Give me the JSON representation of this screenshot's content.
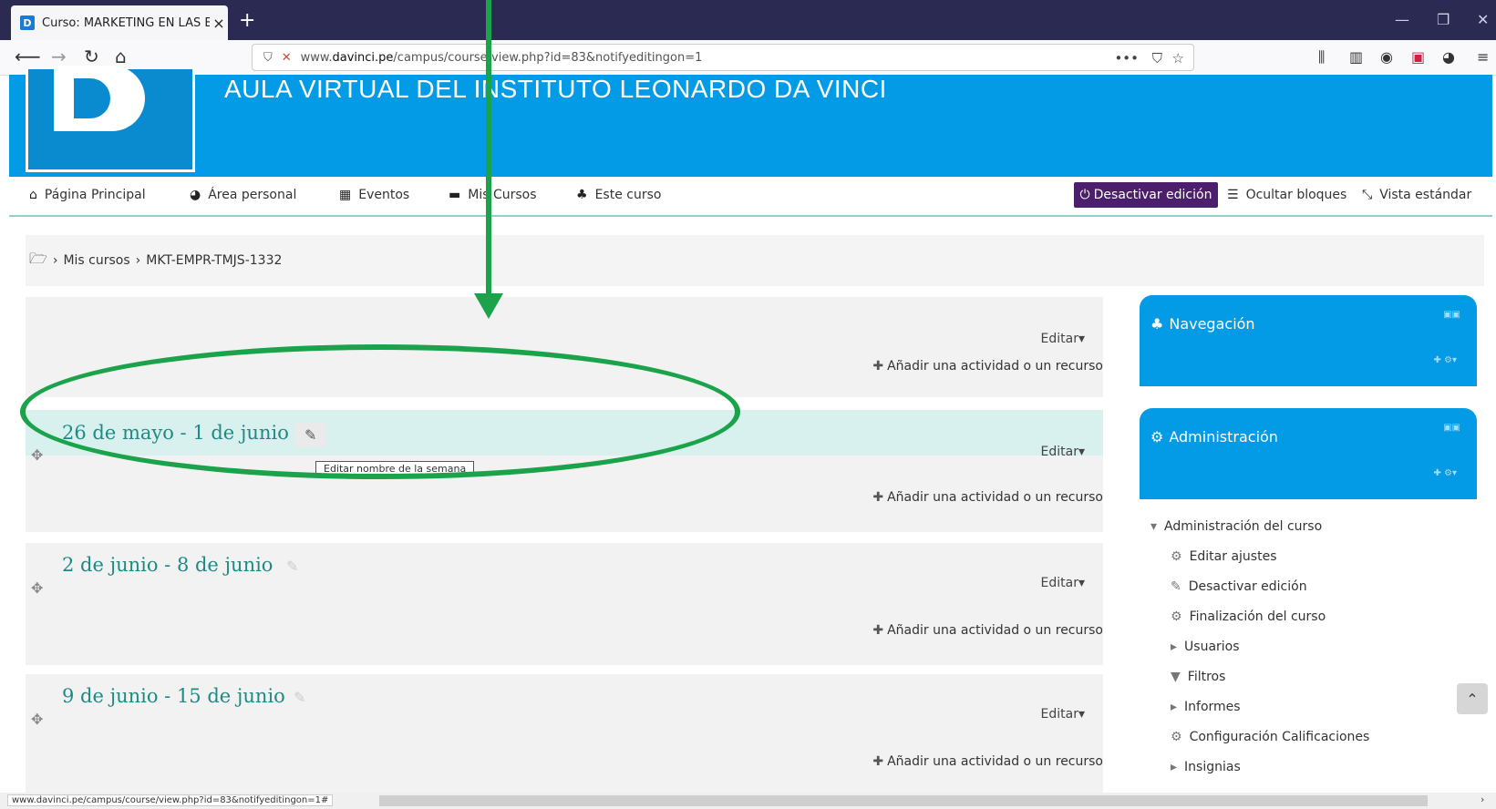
{
  "browser": {
    "tab_title": "Curso: MARKETING EN LAS EM",
    "tab_favicon": "D",
    "url_prefix": "www.",
    "url_domain": "davinci.pe",
    "url_path": "/campus/course/view.php?id=83&notifyeditingon=1",
    "new_tab": "+",
    "url_menu": "•••"
  },
  "header": {
    "site_title": "AULA VIRTUAL DEL INSTITUTO LEONARDO DA VINCI"
  },
  "nav": {
    "home": "Página Principal",
    "personal": "Área personal",
    "events": "Eventos",
    "my_courses": "Mis Cursos",
    "this_course": "Este curso",
    "edit_toggle": "Desactivar edición",
    "hide_blocks": "Ocultar bloques",
    "standard_view": "Vista estándar"
  },
  "breadcrumb": {
    "item1": "Mis cursos",
    "item2": "MKT-EMPR-TMJS-1332"
  },
  "sections": [
    {
      "title": "",
      "edit": "Editar",
      "add": "Añadir una actividad o un recurso"
    },
    {
      "title": "26 de mayo - 1 de junio",
      "edit": "Editar",
      "add": "Añadir una actividad o un recurso"
    },
    {
      "title": "2 de junio - 8 de junio",
      "edit": "Editar",
      "add": "Añadir una actividad o un recurso"
    },
    {
      "title": "9 de junio - 15 de junio",
      "edit": "Editar",
      "add": "Añadir una actividad o un recurso"
    }
  ],
  "tooltip": "Editar nombre de la semana",
  "blocks": {
    "navigation": "Navegación",
    "administration": "Administración"
  },
  "admin": {
    "course_admin": "Administración del curso",
    "items": [
      "Editar ajustes",
      "Desactivar edición",
      "Finalización del curso",
      "Usuarios",
      "Filtros",
      "Informes",
      "Configuración Calificaciones",
      "Insignias"
    ]
  },
  "status_url": "www.davinci.pe/campus/course/view.php?id=83&notifyeditingon=1#",
  "colors": {
    "header": "#039be5",
    "edit_button": "#4b1f6b",
    "section_title": "#1f8a84",
    "annotation": "#1aa34a"
  }
}
